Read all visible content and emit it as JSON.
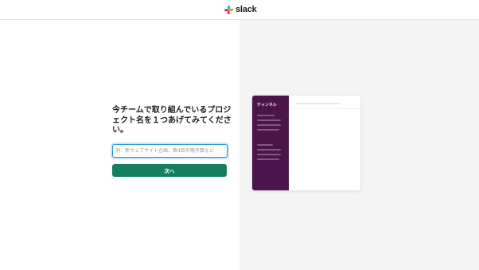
{
  "brand": {
    "name": "slack"
  },
  "form": {
    "title": "今チームで取り組んでいるプロジェクト名を１つあげてみてください。",
    "input_placeholder": "例：新ウェブサイト企画、第4四半期予算など",
    "input_value": "",
    "next_label": "次へ"
  },
  "preview": {
    "workspace_name": "チャンネル"
  },
  "colors": {
    "button": "#137f5e",
    "sidebar": "#4a154b",
    "input_focus": "#1d9bd1",
    "right_pane": "#f4f4f4"
  }
}
